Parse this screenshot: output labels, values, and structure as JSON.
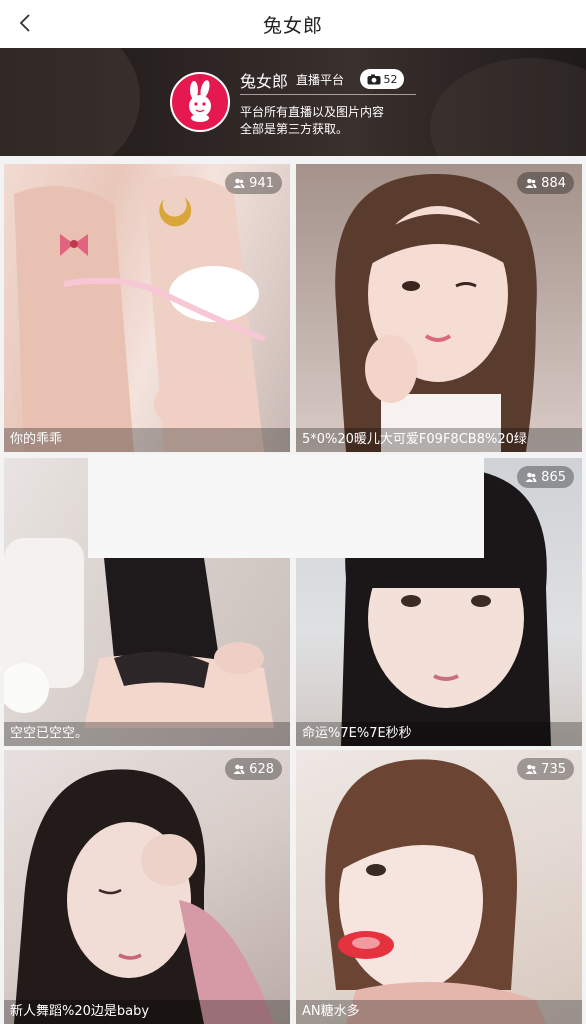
{
  "header": {
    "title": "兔女郎",
    "back_icon": "chevron-left-icon"
  },
  "banner": {
    "brand_name": "兔女郎",
    "brand_sub": "直播平台",
    "viewer_icon": "camera-icon",
    "viewer_count": "52",
    "notice_line1": "平台所有直播以及图片内容",
    "notice_line2": "全部是第三方获取。",
    "logo_icon": "bunny-logo-icon"
  },
  "cards": [
    {
      "viewers": "941",
      "caption": "你的乖乖"
    },
    {
      "viewers": "884",
      "caption": "5*0%20暖儿大可爱F09F8CB8%20绿"
    },
    {
      "viewers": "",
      "caption": "空空已空空。"
    },
    {
      "viewers": "865",
      "caption": "命运%7E%7E秒秒"
    },
    {
      "viewers": "628",
      "caption": "新人舞蹈%20边是baby"
    },
    {
      "viewers": "735",
      "caption": "AN糖水多"
    }
  ],
  "colors": {
    "brand_red": "#e5194f",
    "banner_dark": "#2a2321",
    "badge_bg": "rgba(0,0,0,0.32)"
  }
}
